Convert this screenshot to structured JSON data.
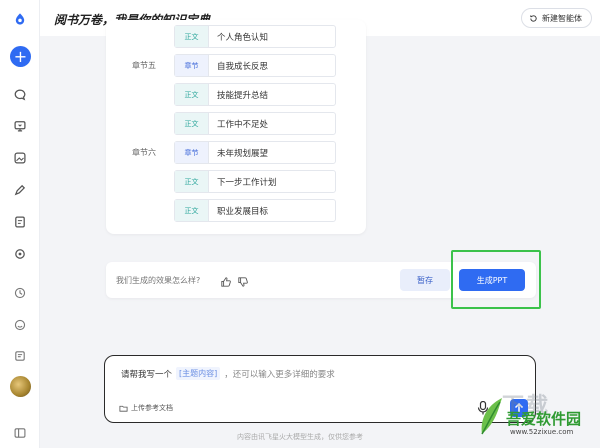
{
  "header": {
    "title": "阅书万卷，我是你的知识宝典",
    "new_agent_label": "新建智能体"
  },
  "rail": {
    "icons": [
      "plus-icon",
      "chat-icon",
      "monitor-icon",
      "image-icon",
      "edit-icon",
      "document-icon",
      "settings-icon",
      "history-icon",
      "smile-icon",
      "notes-icon",
      "avatar",
      "sidebar-toggle-icon"
    ]
  },
  "outline": {
    "rows": [
      {
        "chapter": "",
        "tag": "正文",
        "type": "body",
        "text": "个人角色认知"
      },
      {
        "chapter": "章节五",
        "tag": "章节",
        "type": "chapter",
        "text": "自我成长反思"
      },
      {
        "chapter": "",
        "tag": "正文",
        "type": "body",
        "text": "技能提升总结"
      },
      {
        "chapter": "",
        "tag": "正文",
        "type": "body",
        "text": "工作中不足处"
      },
      {
        "chapter": "章节六",
        "tag": "章节",
        "type": "chapter",
        "text": "未年规划展望"
      },
      {
        "chapter": "",
        "tag": "正文",
        "type": "body",
        "text": "下一步工作计划"
      },
      {
        "chapter": "",
        "tag": "正文",
        "type": "body",
        "text": "职业发展目标"
      }
    ]
  },
  "feedback": {
    "question": "我们生成的效果怎么样?",
    "pause_label": "暂存",
    "generate_label": "生成PPT"
  },
  "composer": {
    "prefix": "请帮我写一个",
    "chip": "[主题内容]",
    "suffix": "，还可以输入更多详细的要求",
    "upload_label": "上传参考文档"
  },
  "disclaimer": "内容由讯飞星火大模型生成，仅供您参考",
  "watermark": {
    "big": "下载",
    "name": "吾爱软件园",
    "url": "www.52zixue.com"
  },
  "colors": {
    "accent": "#2f6bf2",
    "highlight": "#3bc24b",
    "chapter_tag": "#3b65d8",
    "body_tag": "#2aa59b"
  }
}
